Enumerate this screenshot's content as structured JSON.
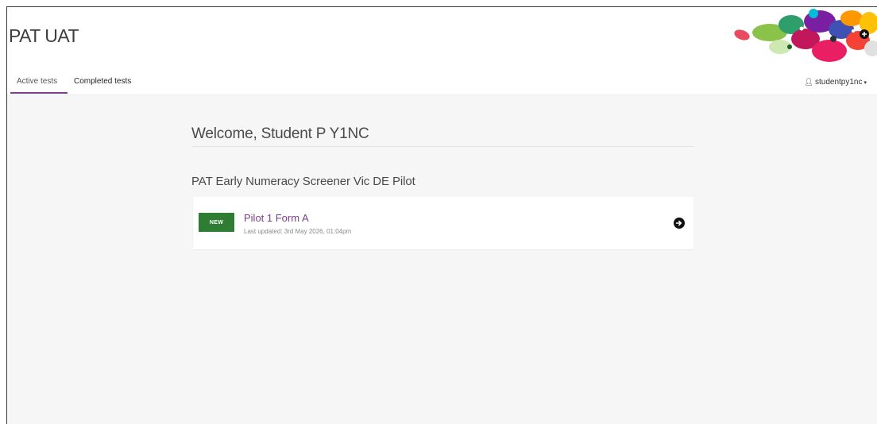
{
  "app": {
    "title": "PAT UAT"
  },
  "nav": {
    "tabs": [
      {
        "label": "Active tests",
        "active": true
      },
      {
        "label": "Completed tests",
        "active": false
      }
    ],
    "user_menu": {
      "label": "studentpy1nc",
      "icon": "user-icon",
      "caret": "▾"
    }
  },
  "main": {
    "welcome": "Welcome, Student P Y1NC",
    "section_title": "PAT Early Numeracy Screener Vic DE Pilot",
    "tests": [
      {
        "badge": "NEW",
        "name": "Pilot 1 Form A",
        "updated": "Last updated: 3rd May 2026, 01:04pm",
        "action_icon": "arrow-right-circle-icon"
      }
    ]
  },
  "colors": {
    "accent": "#7b3f8c",
    "badge_green": "#2e7d32",
    "page_bg": "#f6f6f6"
  }
}
